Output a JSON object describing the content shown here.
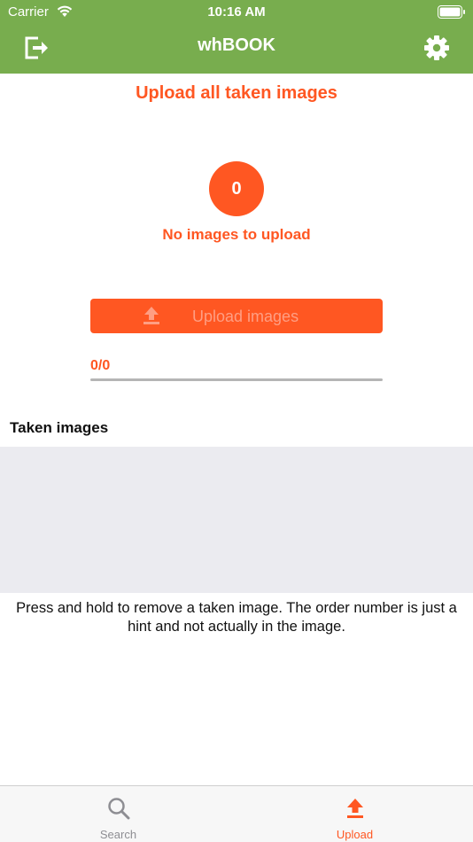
{
  "status_bar": {
    "carrier": "Carrier",
    "time": "10:16 AM"
  },
  "nav": {
    "title": "whBOOK",
    "left_icon": "logout-icon",
    "right_icon": "gear-icon"
  },
  "main": {
    "title": "Upload all taken images",
    "count": "0",
    "count_caption": "No images to upload",
    "upload_button_label": "Upload images",
    "progress_text": "0/0",
    "progress_fraction": 0,
    "section_title": "Taken images",
    "hint": "Press and hold to remove a taken image. The order number is just a hint and not actually in the image."
  },
  "tabs": [
    {
      "label": "Search",
      "icon": "search-icon",
      "active": false
    },
    {
      "label": "Upload",
      "icon": "upload-icon",
      "active": true
    }
  ],
  "colors": {
    "header": "#78ad4e",
    "accent": "#ff5722",
    "inactive_tab": "#8e8e93",
    "images_background": "#ebebf0"
  }
}
